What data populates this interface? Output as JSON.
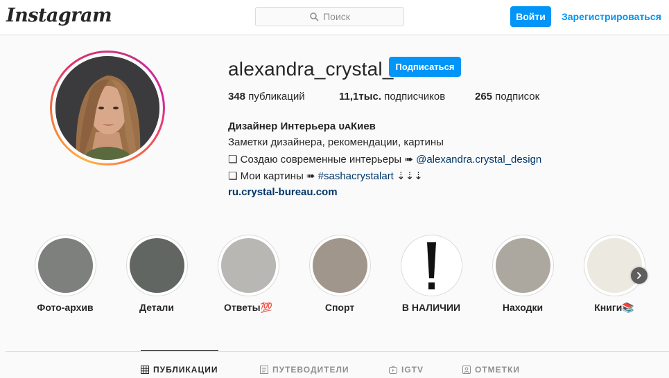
{
  "header": {
    "logo_text": "Instagram",
    "search_placeholder": "Поиск",
    "login_label": "Войти",
    "register_label": "Зарегистрироваться"
  },
  "profile": {
    "username": "alexandra_crystal_",
    "follow_label": "Подписаться",
    "stats": {
      "posts_count": "348",
      "posts_label": "публикаций",
      "followers_count": "11,1тыс.",
      "followers_label": "подписчиков",
      "following_count": "265",
      "following_label": "подписок"
    },
    "bio": {
      "name": "Дизайнер Интерьера ᴜᴀКиев",
      "line1": "Заметки дизайнера, рекомендации, картины",
      "line2_prefix": "❏ Создаю современные интерьеры ➠ ",
      "line2_mention": "@alexandra.crystal_design",
      "line3_prefix": "❏ Мои картины ➠ ",
      "line3_mention": "#sashacrystalart",
      "line3_suffix": " ⇣⇣⇣",
      "website": "ru.crystal-bureau.com"
    }
  },
  "highlights": [
    {
      "label": "Фото-архив",
      "color": "#7d807d"
    },
    {
      "label": "Детали",
      "color": "#626662"
    },
    {
      "label": "Ответы💯",
      "color": "#b8b7b3"
    },
    {
      "label": "Спорт",
      "color": "#a1968b"
    },
    {
      "label": "В НАЛИЧИИ",
      "color": "#ffffff"
    },
    {
      "label": "Находки",
      "color": "#aca8a0"
    },
    {
      "label": "Книги📚",
      "color": "#ece9e0"
    }
  ],
  "tabs": [
    {
      "label": "ПУБЛИКАЦИИ",
      "icon": "grid-icon",
      "active": true
    },
    {
      "label": "ПУТЕВОДИТЕЛИ",
      "icon": "guide-icon",
      "active": false
    },
    {
      "label": "IGTV",
      "icon": "igtv-icon",
      "active": false
    },
    {
      "label": "ОТМЕТКИ",
      "icon": "tagged-icon",
      "active": false
    }
  ],
  "colors": {
    "accent": "#0095f6",
    "link": "#00376b"
  }
}
